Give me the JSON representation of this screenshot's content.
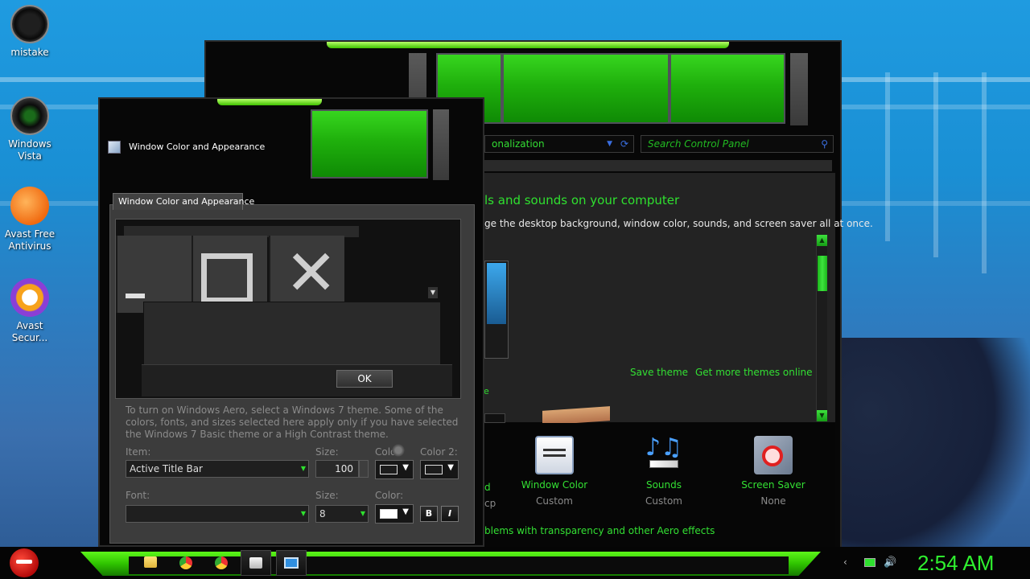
{
  "desktop": {
    "icons": [
      {
        "label": "mistake"
      },
      {
        "label": "Windows Vista"
      },
      {
        "label": "Avast Free Antivirus"
      },
      {
        "label": "Avast Secur..."
      }
    ]
  },
  "back_window": {
    "address": "onalization",
    "search_placeholder": "Search Control Panel",
    "heading": "ls and sounds on your computer",
    "subheading": "ge the desktop background, window color, sounds, and screen saver all at once.",
    "thumb_label_fragment": "e",
    "links": {
      "save_theme": "Save theme",
      "get_more": "Get more themes online"
    },
    "options": [
      {
        "title_fragment": "d",
        "status_fragment": "cp"
      },
      {
        "title": "Window Color",
        "status": "Custom"
      },
      {
        "title": "Sounds",
        "status": "Custom"
      },
      {
        "title": "Screen Saver",
        "status": "None"
      }
    ],
    "troubleshoot": "blems with transparency and other Aero effects"
  },
  "dialog": {
    "title": "Window Color and Appearance",
    "tab_label": "Window Color and Appearance",
    "ok_label": "OK",
    "note": "To turn on Windows Aero, select a Windows 7 theme.  Some of the colors, fonts, and sizes selected here apply only if you have selected the Windows 7 Basic theme or a High Contrast theme.",
    "item_label": "Item:",
    "item_value": "Active Title Bar",
    "size_label": "Size:",
    "size_value": "100",
    "color1_label": "Colo",
    "color2_label": "Color 2:",
    "font_label": "Font:",
    "font_value": "",
    "font_size_label": "Size:",
    "font_size_value": "8",
    "font_color_label": "Color:",
    "bold": "B",
    "italic": "I"
  },
  "taskbar": {
    "clock": "2:54 AM",
    "accent": "#2fe02f"
  }
}
